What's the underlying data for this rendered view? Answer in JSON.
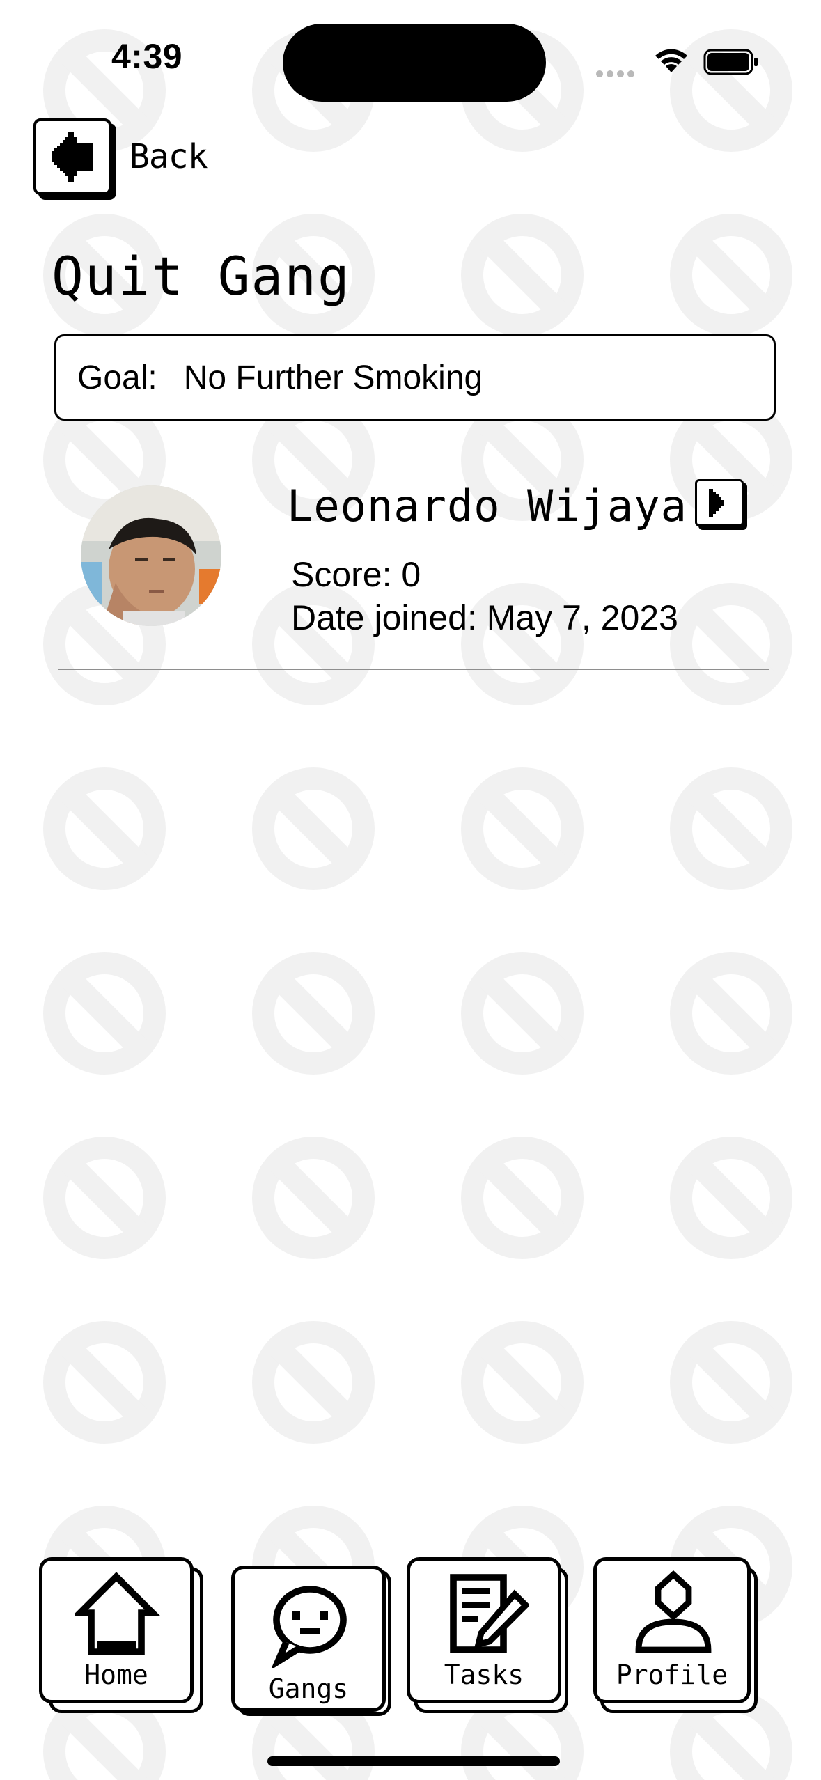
{
  "status_bar": {
    "time": "4:39"
  },
  "nav": {
    "back_label": "Back"
  },
  "page": {
    "title": "Quit Gang"
  },
  "goal": {
    "label": "Goal:",
    "value": "No Further Smoking"
  },
  "members": [
    {
      "name": "Leonardo Wijaya",
      "score_text": "Score: 0",
      "date_text": "Date joined: May 7, 2023"
    }
  ],
  "tab_bar": {
    "items": [
      {
        "label": "Home",
        "icon": "house-icon"
      },
      {
        "label": "Gangs",
        "icon": "speech-bubble-icon"
      },
      {
        "label": "Tasks",
        "icon": "notepad-pencil-icon"
      },
      {
        "label": "Profile",
        "icon": "person-icon"
      }
    ]
  },
  "colors": {
    "background": "#ffffff",
    "ink": "#000000",
    "pattern": "#f1f1f1",
    "divider": "#8e8e8e"
  }
}
